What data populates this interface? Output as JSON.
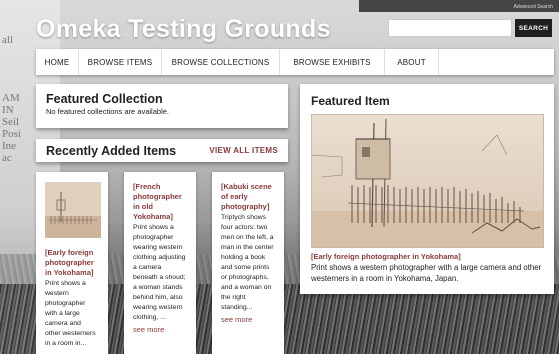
{
  "site": {
    "title": "Omeka Testing Grounds",
    "advanced_search": "Advanced Search"
  },
  "search": {
    "placeholder": "",
    "button_label": "SEARCH"
  },
  "nav": {
    "items": [
      "HOME",
      "BROWSE ITEMS",
      "BROWSE COLLECTIONS",
      "BROWSE EXHIBITS",
      "ABOUT"
    ]
  },
  "featured_collection": {
    "heading": "Featured Collection",
    "message": "No featured collections are available."
  },
  "recently_added": {
    "heading": "Recently Added Items",
    "view_all": "VIEW ALL ITEMS",
    "items": [
      {
        "title": "[Early foreign photographer in Yokohama]",
        "description": "Print shows a western photographer with a large camera and other westerners in a room in...",
        "more": ""
      },
      {
        "title": "[French photographer in old Yokohama]",
        "description": "Print shows a photographer wearing western clothing adjusting a camera beneath a shoud; a woman stands behind him, also wearing western clothing, ...",
        "more": "see more"
      },
      {
        "title": "[Kabuki scene of early photography]",
        "description": "Triptych shows four actors: two men on the left, a man in the center holding a book and some prints or photographs, and a woman on the right standing...",
        "more": "see more"
      }
    ]
  },
  "featured_item": {
    "heading": "Featured Item",
    "caption": "[Early foreign photographer in Yokohama]",
    "description": "Print shows a western photographer with a large camera and other westerners in a room in Yokohama, Japan."
  },
  "colors": {
    "link": "#8b3a3a",
    "nav_bg": "#ffffff",
    "search_button": "#1f1f1f"
  }
}
